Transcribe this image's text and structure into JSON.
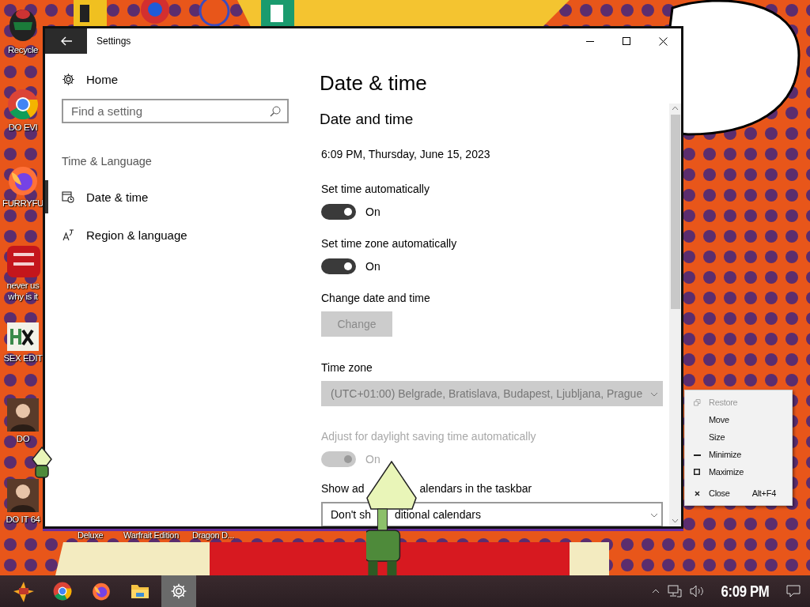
{
  "desktop": {
    "icons": [
      {
        "label": "Recycle",
        "kind": "helmet"
      },
      {
        "label": "DO EVI",
        "kind": "chrome"
      },
      {
        "label": "FURRYFU",
        "kind": "firefox"
      },
      {
        "label": "never us\nwhy is it",
        "kind": "ide"
      },
      {
        "label": "SEX EDIT",
        "kind": "hex"
      },
      {
        "label": "DO",
        "kind": "portrait"
      },
      {
        "label": "DO IT 64",
        "kind": "portrait"
      }
    ],
    "bottom_labels": [
      "Deluxe",
      "Warfrait Edition",
      "Dragon D..."
    ]
  },
  "window": {
    "title": "Settings",
    "sidebar": {
      "home": "Home",
      "search": {
        "placeholder": "Find a setting"
      },
      "category": "Time & Language",
      "items": [
        {
          "label": "Date & time",
          "selected": true,
          "kind": "clock"
        },
        {
          "label": "Region & language",
          "selected": false,
          "kind": "language"
        }
      ]
    },
    "page_title": "Date & time",
    "section_title": "Date and time",
    "current_time": "6:09 PM, Thursday, June 15, 2023",
    "settings": [
      {
        "kind": "toggle",
        "label": [
          "Set time automatically"
        ],
        "on": true,
        "disabled": false,
        "state": "On"
      },
      {
        "kind": "toggle",
        "label": [
          "Set time zone automatically"
        ],
        "on": true,
        "disabled": false,
        "state": "On"
      },
      {
        "kind": "button",
        "label": [
          "Change date and time"
        ],
        "button": "Change",
        "disabled": true
      },
      {
        "kind": "dropdown",
        "label": [
          "Time zone"
        ],
        "value": [
          "(UTC+01:00) Belgrade, Bratislava, Budapest, Ljubljana, Prague"
        ],
        "disabled": true
      },
      {
        "kind": "toggle",
        "label": [
          "Adjust for daylight saving time automatically"
        ],
        "on": true,
        "disabled": true,
        "state": "On"
      },
      {
        "kind": "dropdown",
        "label": [
          "Show ad",
          "alendars in the taskbar"
        ],
        "value": [
          "Don't sh",
          "ditional calendars"
        ],
        "disabled": false
      }
    ]
  },
  "context_menu": [
    {
      "label": "Restore",
      "kind": "restore",
      "disabled": true
    },
    {
      "label": "Move",
      "kind": "move",
      "disabled": false
    },
    {
      "label": "Size",
      "kind": "size",
      "disabled": false
    },
    {
      "label": "Minimize",
      "kind": "minimize",
      "disabled": false
    },
    {
      "label": "Maximize",
      "kind": "maximize",
      "disabled": false
    },
    {
      "label": "Close",
      "kind": "close",
      "disabled": false,
      "shortcut": "Alt+F4"
    }
  ],
  "taskbar": {
    "apps": [
      {
        "kind": "logo",
        "selected": false
      },
      {
        "kind": "chrome",
        "selected": false
      },
      {
        "kind": "firefox",
        "selected": false
      },
      {
        "kind": "folder",
        "selected": false
      },
      {
        "kind": "settings",
        "selected": true
      }
    ],
    "clock": "6:09 PM"
  }
}
